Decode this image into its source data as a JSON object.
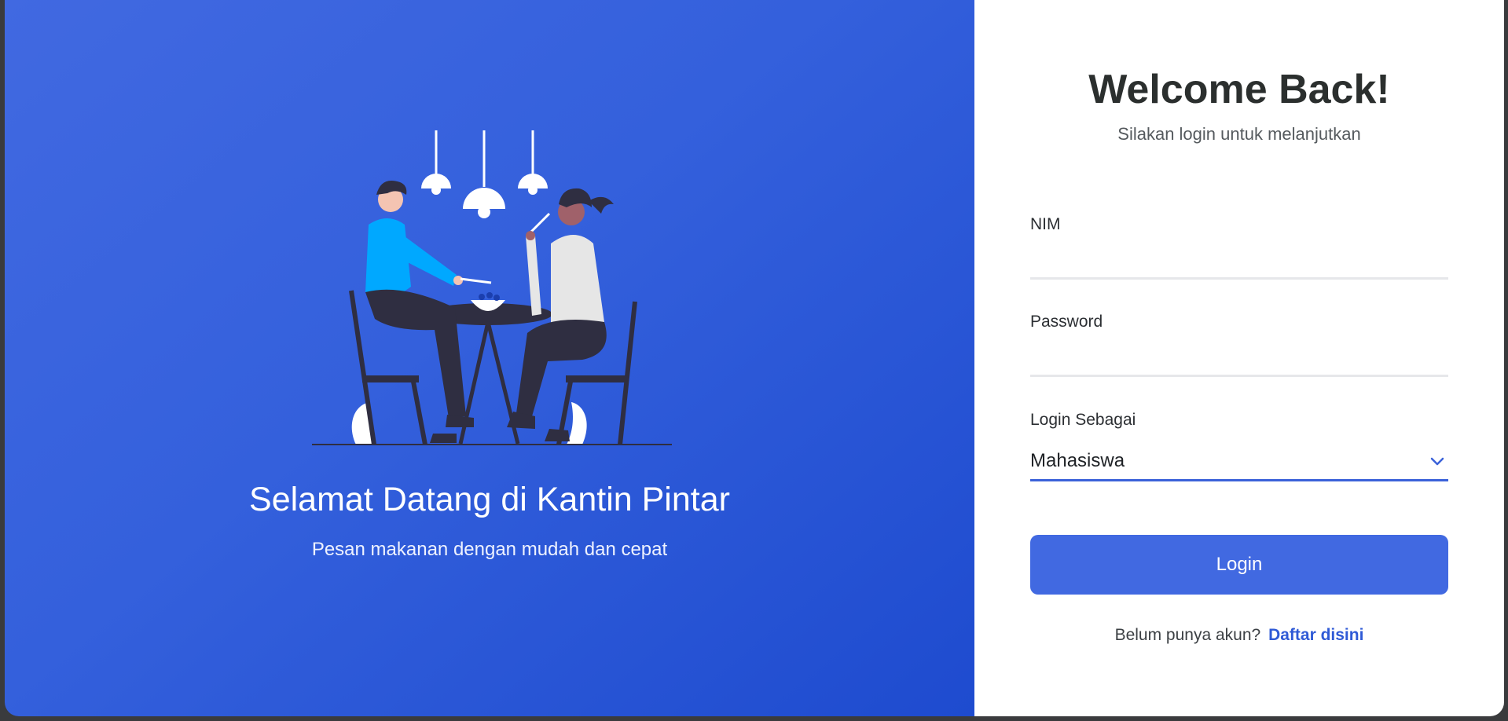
{
  "hero": {
    "title": "Selamat Datang di Kantin Pintar",
    "subtitle": "Pesan makanan dengan mudah dan cepat",
    "illustration": "people-eating-at-table-illustration"
  },
  "form": {
    "title": "Welcome Back!",
    "subtitle": "Silakan login untuk melanjutkan",
    "nim_label": "NIM",
    "nim_value": "",
    "password_label": "Password",
    "password_value": "",
    "role_label": "Login Sebagai",
    "role_value": "Mahasiswa",
    "submit_label": "Login",
    "signup_prompt": "Belum punya akun?",
    "signup_link": "Daftar disini"
  },
  "colors": {
    "primary": "#4169e1",
    "link": "#2f5ad6",
    "hero_gradient_end": "#1e4bcf"
  },
  "icons": {
    "role_select": "chevron-down-icon"
  }
}
